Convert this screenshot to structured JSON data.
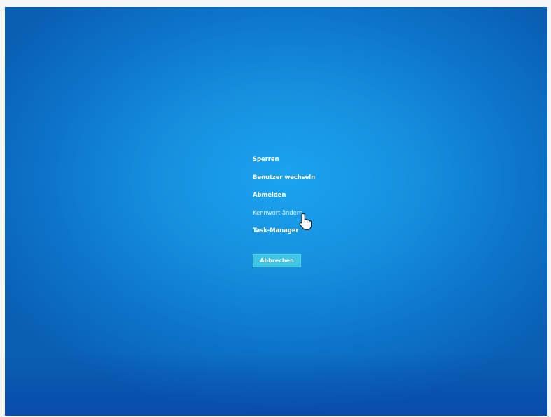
{
  "security_options": {
    "items": [
      {
        "label": "Sperren"
      },
      {
        "label": "Benutzer wechseln"
      },
      {
        "label": "Abmelden"
      },
      {
        "label": "Kennwort ändern"
      },
      {
        "label": "Task-Manager"
      }
    ],
    "hovered_item": "Kennwort ändern",
    "cancel_label": "Abbrechen"
  },
  "colors": {
    "background": "#1690de",
    "button": "#3cc4e4",
    "text": "#ffffff"
  },
  "cursor": "hand-pointer-icon"
}
